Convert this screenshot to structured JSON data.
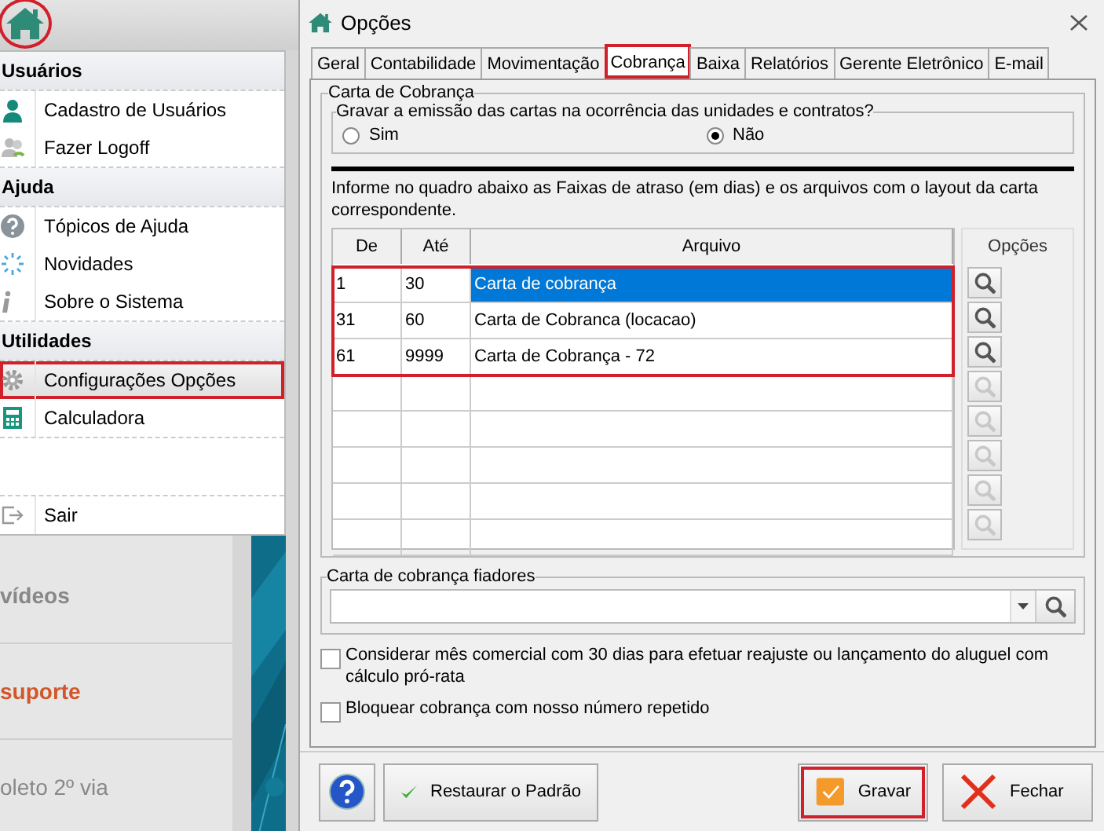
{
  "side_menu": {
    "home_button": {
      "highlighted": true
    },
    "sections": [
      {
        "title": "Usuários",
        "items": [
          {
            "label": "Cadastro de Usuários",
            "kind": "user",
            "highlighted": false
          },
          {
            "label": "Fazer Logoff",
            "kind": "logoff",
            "highlighted": false
          }
        ]
      },
      {
        "title": "Ajuda",
        "items": [
          {
            "label": "Tópicos de Ajuda",
            "kind": "help",
            "highlighted": false
          },
          {
            "label": "Novidades",
            "kind": "news",
            "highlighted": false
          },
          {
            "label": "Sobre o Sistema",
            "kind": "info",
            "highlighted": false
          }
        ]
      },
      {
        "title": "Utilidades",
        "items": [
          {
            "label": "Configurações Opções",
            "kind": "gear",
            "highlighted": true
          },
          {
            "label": "Calculadora",
            "kind": "calculator",
            "highlighted": false
          }
        ]
      }
    ],
    "footer_items": [
      {
        "label": "Sair",
        "kind": "exit",
        "highlighted": false
      }
    ]
  },
  "background_panel": {
    "links": [
      {
        "label": "vídeos",
        "kind": "muted"
      },
      {
        "label": "suporte",
        "kind": "accent"
      },
      {
        "label": "oleto 2º via",
        "kind": "plain"
      }
    ]
  },
  "dialog": {
    "title": "Opções",
    "tabs": [
      {
        "label": "Geral",
        "selected": false,
        "highlighted": false
      },
      {
        "label": "Contabilidade",
        "selected": false,
        "highlighted": false
      },
      {
        "label": "Movimentação",
        "selected": false,
        "highlighted": false
      },
      {
        "label": "Cobrança",
        "selected": true,
        "highlighted": true
      },
      {
        "label": "Baixa",
        "selected": false,
        "highlighted": false
      },
      {
        "label": "Relatórios",
        "selected": false,
        "highlighted": false
      },
      {
        "label": "Gerente Eletrônico",
        "selected": false,
        "highlighted": false
      },
      {
        "label": "E-mail",
        "selected": false,
        "highlighted": false
      }
    ],
    "group_title": "Carta de Cobrança",
    "question": {
      "title": "Gravar a emissão das cartas na ocorrência das unidades e contratos?",
      "options": [
        {
          "label": "Sim",
          "selected": false
        },
        {
          "label": "Não",
          "selected": true
        }
      ]
    },
    "info_text": "Informe no quadro abaixo as Faixas de atraso (em dias) e os arquivos com o layout  da carta correspondente.",
    "table": {
      "columns": [
        "De",
        "Até",
        "Arquivo"
      ],
      "options_header": "Opções",
      "rows": [
        {
          "de": "1",
          "ate": "30",
          "arquivo": "Carta de cobrança",
          "selected": true,
          "highlighted": true,
          "search_disabled": false
        },
        {
          "de": "31",
          "ate": "60",
          "arquivo": "Carta de Cobranca (locacao)",
          "selected": false,
          "highlighted": true,
          "search_disabled": false
        },
        {
          "de": "61",
          "ate": "9999",
          "arquivo": "Carta de Cobrança - 72",
          "selected": false,
          "highlighted": true,
          "search_disabled": false
        },
        {
          "selected": false,
          "highlighted": false,
          "search_disabled": true
        },
        {
          "selected": false,
          "highlighted": false,
          "search_disabled": true
        },
        {
          "selected": false,
          "highlighted": false,
          "search_disabled": true
        },
        {
          "selected": false,
          "highlighted": false,
          "search_disabled": true
        },
        {
          "selected": false,
          "highlighted": false,
          "search_disabled": true
        }
      ]
    },
    "fiadores": {
      "title": "Carta de cobrança fiadores"
    },
    "checkboxes": [
      {
        "label": "Considerar mês comercial com 30 dias para efetuar reajuste ou lançamento do aluguel com cálculo pró-rata",
        "checked": false
      },
      {
        "label": "Bloquear cobrança com nosso número repetido",
        "checked": false
      }
    ],
    "buttons": [
      {
        "kind": "help",
        "highlighted": false
      },
      {
        "kind": "restore",
        "label": "Restaurar o Padrão",
        "highlighted": false
      },
      {
        "kind": "save",
        "label": "Gravar",
        "highlighted": true
      },
      {
        "kind": "close",
        "label": "Fechar",
        "highlighted": false
      }
    ]
  }
}
